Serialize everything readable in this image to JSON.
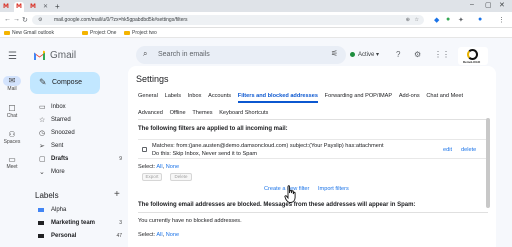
{
  "browser": {
    "url": "mail.google.com/mail/u/0/?zx=hk5gpabdbd5k#settings/filters",
    "bookmarks": [
      "New Gmail outlook",
      "Project One",
      "Project two"
    ]
  },
  "header": {
    "app_name": "Gmail",
    "search_placeholder": "Search in emails",
    "status": "Active",
    "badge_text": "DemoLOGO"
  },
  "rail": [
    {
      "label": "Mail",
      "icon": "mail-icon"
    },
    {
      "label": "Chat",
      "icon": "chat-icon"
    },
    {
      "label": "Spaces",
      "icon": "spaces-icon"
    },
    {
      "label": "Meet",
      "icon": "meet-icon"
    }
  ],
  "sidebar": {
    "compose": "Compose",
    "nav": [
      {
        "label": "Inbox",
        "icon": "inbox-icon"
      },
      {
        "label": "Starred",
        "icon": "star-icon"
      },
      {
        "label": "Snoozed",
        "icon": "clock-icon"
      },
      {
        "label": "Sent",
        "icon": "send-icon"
      },
      {
        "label": "Drafts",
        "icon": "draft-icon",
        "count": "9"
      },
      {
        "label": "More",
        "icon": "chevron-down-icon"
      }
    ],
    "labels_heading": "Labels",
    "labels": [
      {
        "label": "Alpha",
        "color": "#4285f4"
      },
      {
        "label": "Marketing team",
        "color": "#202124",
        "count": "3"
      },
      {
        "label": "Personal",
        "color": "#202124",
        "count": "47"
      }
    ]
  },
  "settings": {
    "title": "Settings",
    "tabs_row1": [
      "General",
      "Labels",
      "Inbox",
      "Accounts",
      "Filters and blocked addresses",
      "Forwarding and POP/IMAP",
      "Add-ons",
      "Chat and Meet"
    ],
    "tabs_row2": [
      "Advanced",
      "Offline",
      "Themes",
      "Keyboard Shortcuts"
    ],
    "active_tab": "Filters and blocked addresses",
    "filters_heading": "The following filters are applied to all incoming mail:",
    "filter": {
      "matches": "Matches: from:(jane.austen@demo.damsoncloud.com) subject:(Your Payslip) has:attachment",
      "action": "Do this: Skip Inbox, Never send it to Spam",
      "edit": "edit",
      "delete": "delete"
    },
    "select_label": "Select:",
    "select_all": "All",
    "select_none": "None",
    "export_btn": "Export",
    "delete_btn": "Delete",
    "create_filter": "Create a new filter",
    "import_filters": "Import filters",
    "blocked_heading": "The following email addresses are blocked. Messages from these addresses will appear in Spam:",
    "no_blocked": "You currently have no blocked addresses.",
    "select2_label": "Select:",
    "select2_all": "All",
    "select2_none": "None"
  }
}
